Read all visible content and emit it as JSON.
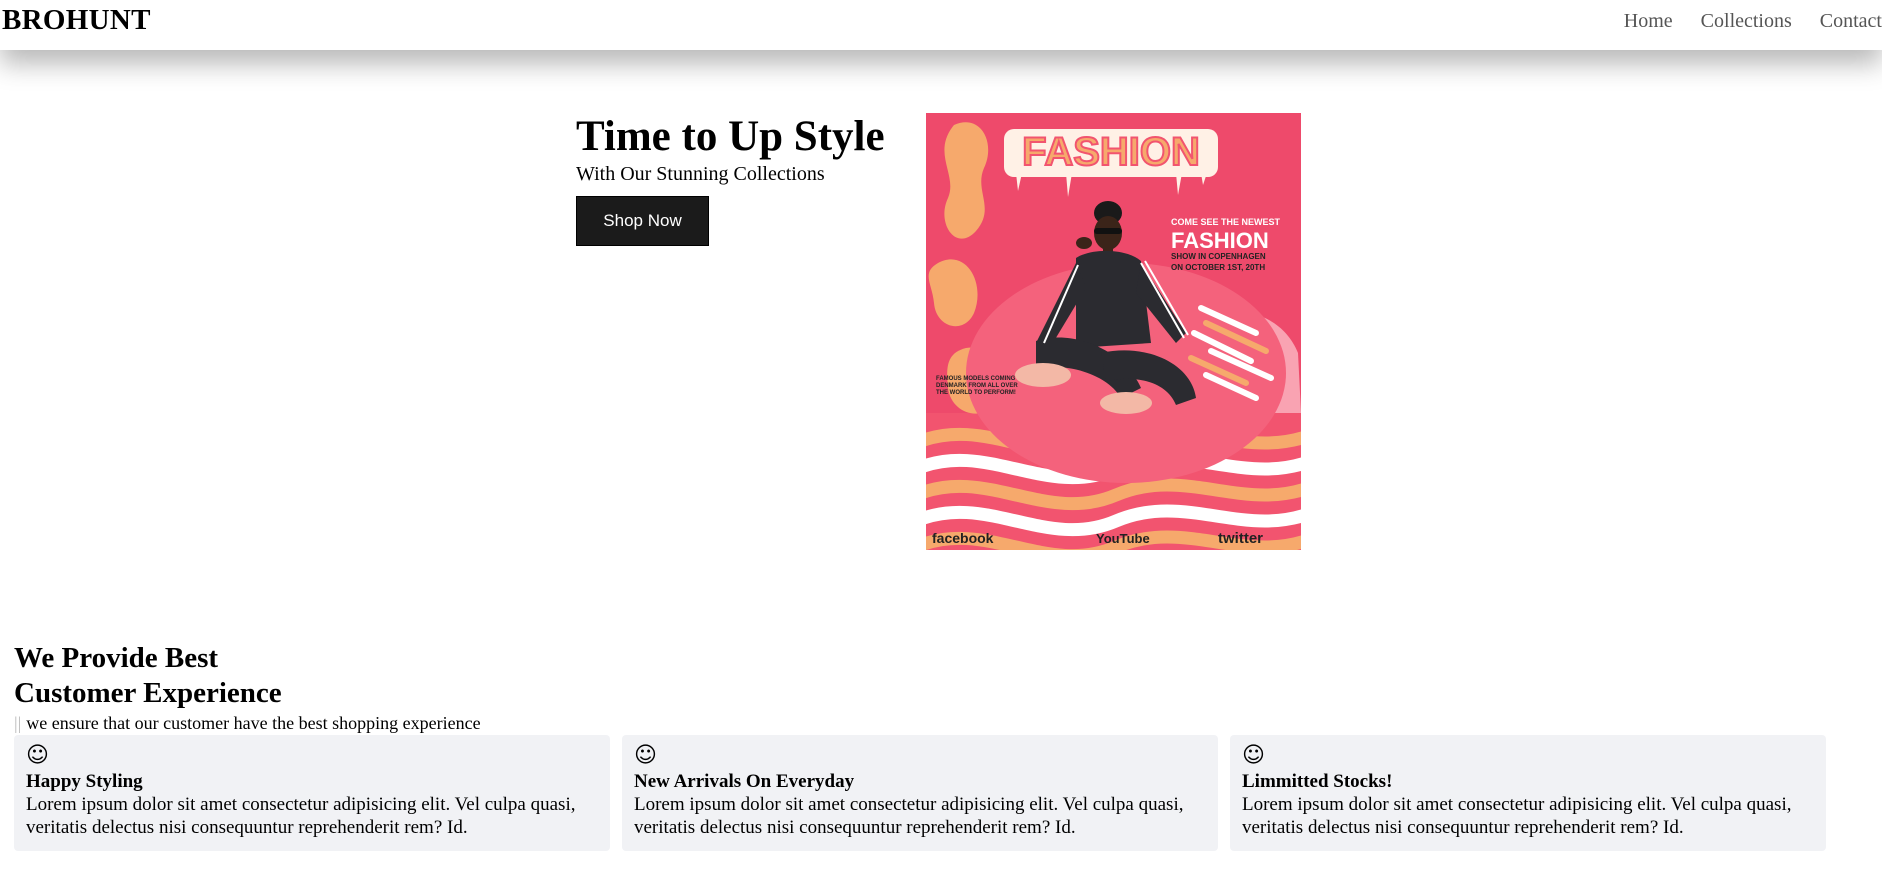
{
  "brand": "BROHUNT",
  "nav": {
    "items": [
      {
        "label": "Home"
      },
      {
        "label": "Collections"
      },
      {
        "label": "Contact"
      }
    ]
  },
  "hero": {
    "title": "Time to Up Style",
    "subtitle": "With Our Stunning Collections",
    "cta_label": "Shop Now",
    "poster": {
      "headline": "FASHION",
      "line1": "COME SEE THE NEWEST",
      "line2": "FASHION",
      "line3": "SHOW IN COPENHAGEN",
      "line4": "ON OCTOBER 1ST, 20TH",
      "side_note_1": "FAMOUS MODELS COMING TO",
      "side_note_2": "DENMARK FROM ALL OVER",
      "side_note_3": "THE WORLD TO PERFORM!",
      "social": [
        "facebook",
        "YouTube",
        "twitter"
      ],
      "colors": {
        "background": "#f2546f",
        "accent": "#f6a96c",
        "cream": "#fff1e6"
      }
    }
  },
  "features": {
    "title_line1": "We Provide Best",
    "title_line2": "Customer Experience",
    "subtitle_marker": "||",
    "subtitle": "we ensure that our customer have the best shopping experience",
    "cards": [
      {
        "icon": "smiley-icon",
        "glyph": "☺",
        "title": "Happy Styling",
        "text": "Lorem ipsum dolor sit amet consectetur adipisicing elit. Vel culpa quasi, veritatis delectus nisi consequuntur reprehenderit rem? Id."
      },
      {
        "icon": "smiley-icon",
        "glyph": "☺",
        "title": "New Arrivals On Everyday",
        "text": "Lorem ipsum dolor sit amet consectetur adipisicing elit. Vel culpa quasi, veritatis delectus nisi consequuntur reprehenderit rem? Id."
      },
      {
        "icon": "smiley-icon",
        "glyph": "☺",
        "title": "Limmitted Stocks!",
        "text": "Lorem ipsum dolor sit amet consectetur adipisicing elit. Vel culpa quasi, veritatis delectus nisi consequuntur reprehenderit rem? Id."
      }
    ]
  }
}
